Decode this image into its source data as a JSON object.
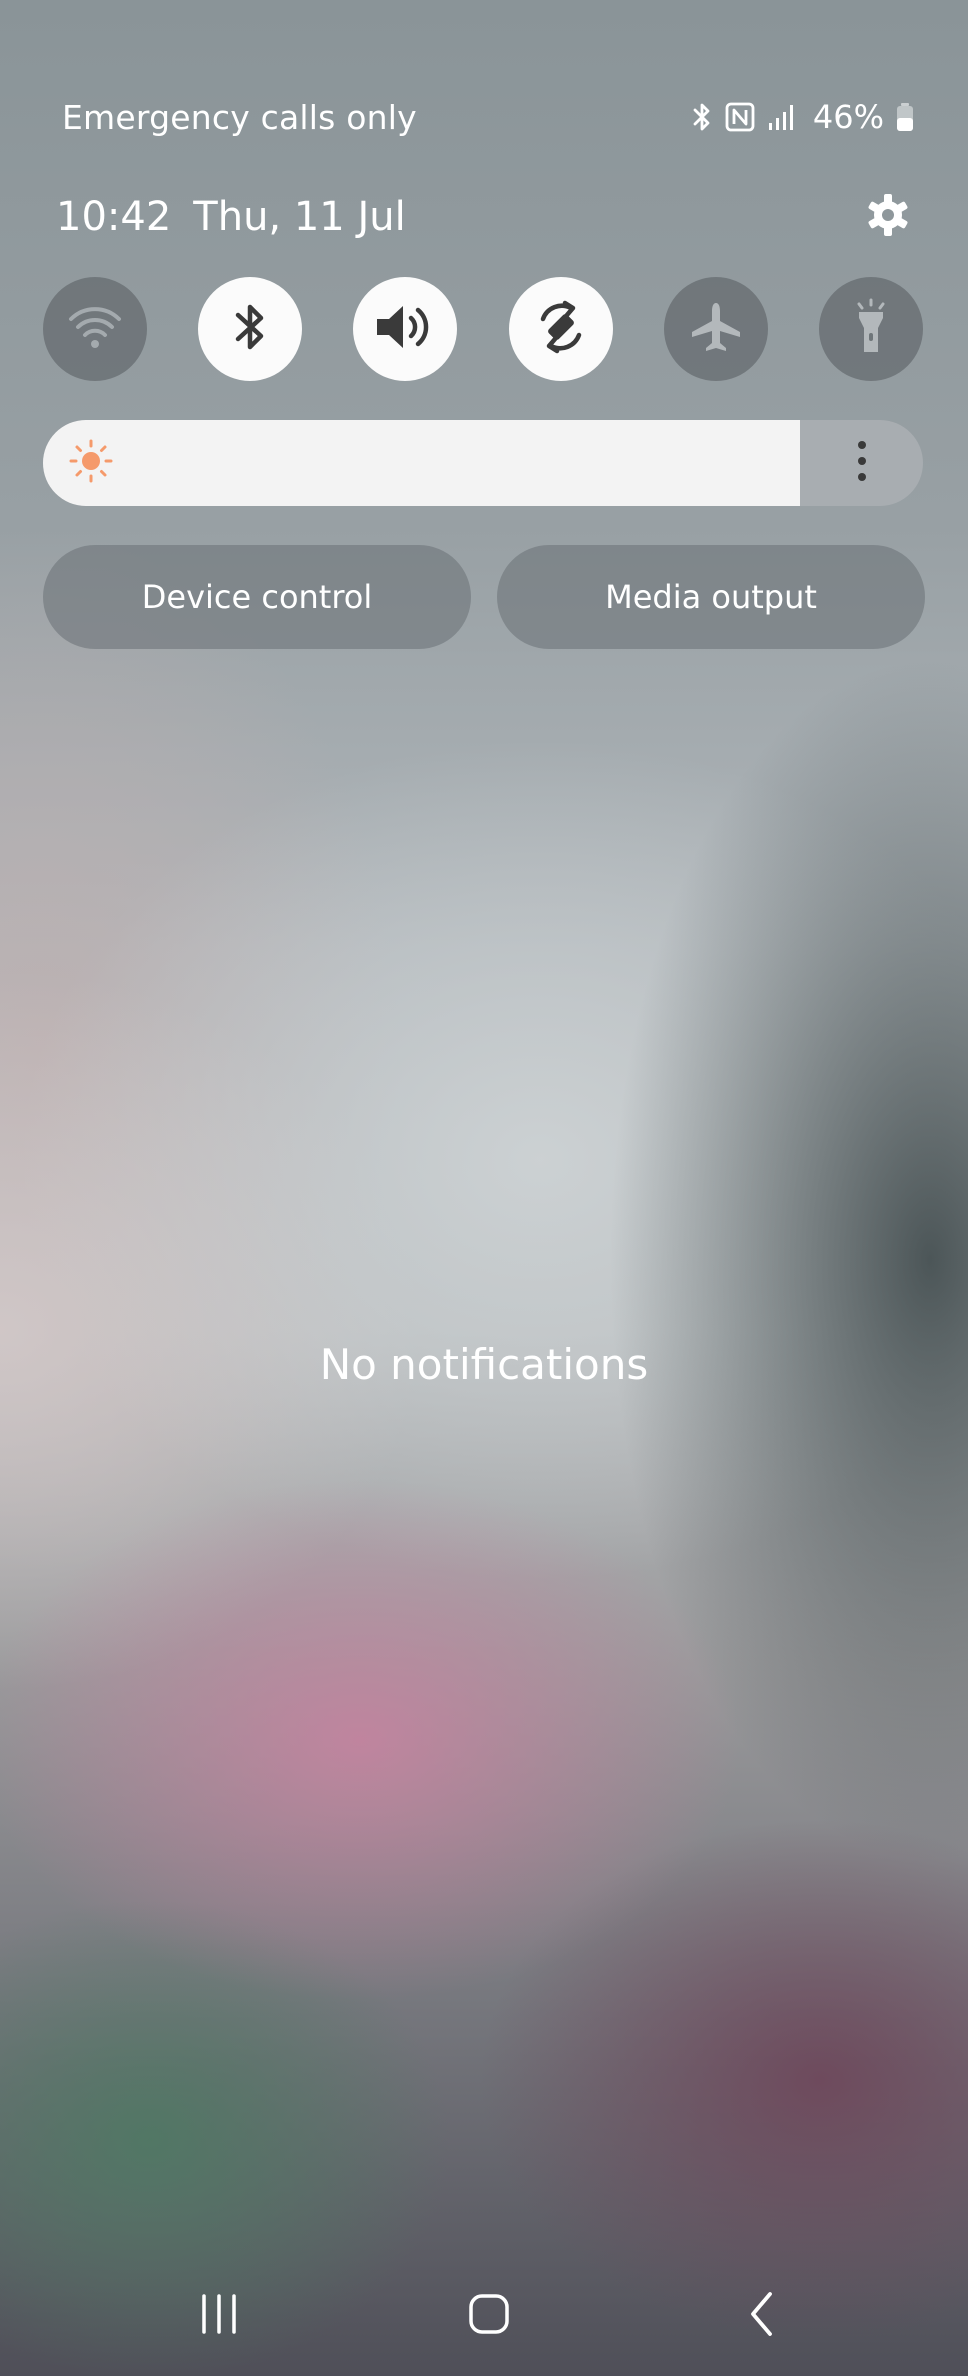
{
  "status_bar": {
    "carrier": "Emergency calls only",
    "icons": [
      "bluetooth-icon",
      "nfc-icon",
      "signal-icon",
      "battery-icon"
    ],
    "battery": "46%"
  },
  "header": {
    "time": "10:42",
    "date": "Thu, 11 Jul",
    "settings_icon": "gear-icon"
  },
  "quick_toggles": [
    {
      "name": "Wi-Fi",
      "icon": "wifi-icon",
      "state": "off"
    },
    {
      "name": "Bluetooth",
      "icon": "bluetooth-icon",
      "state": "on"
    },
    {
      "name": "Sound",
      "icon": "volume-icon",
      "state": "on"
    },
    {
      "name": "Auto rotate",
      "icon": "rotate-icon",
      "state": "on"
    },
    {
      "name": "Airplane mode",
      "icon": "airplane-icon",
      "state": "off"
    },
    {
      "name": "Torch",
      "icon": "flashlight-icon",
      "state": "off"
    }
  ],
  "brightness": {
    "level": 0.86,
    "icon": "sun-icon",
    "accent": "#f59a6b"
  },
  "buttons": {
    "device_control": "Device control",
    "media_output": "Media output"
  },
  "notifications": {
    "empty_text": "No notifications"
  },
  "nav_bar": {
    "recents_icon": "recents-icon",
    "home_icon": "home-icon",
    "back_icon": "back-icon"
  }
}
